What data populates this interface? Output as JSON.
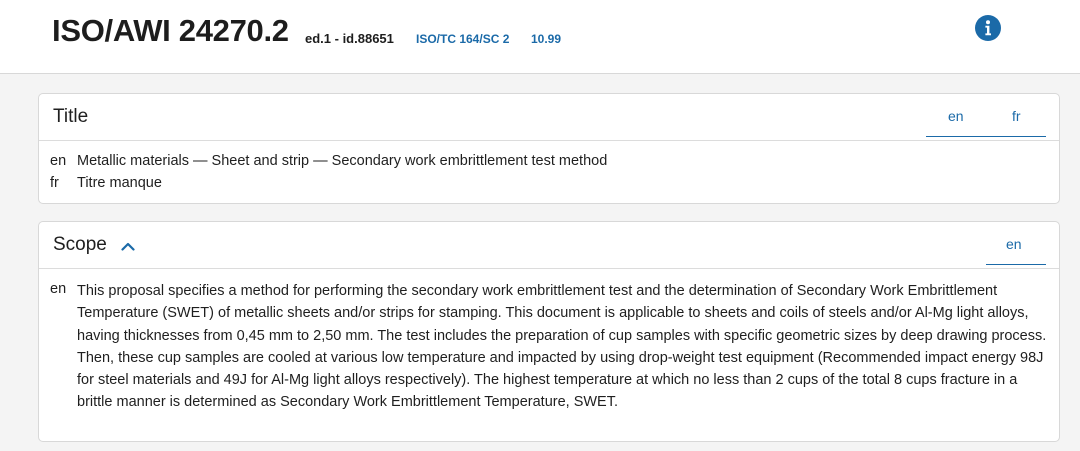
{
  "header": {
    "reference": "ISO/AWI 24270.2",
    "edition": "ed.1 - id.88651",
    "committee": "ISO/TC 164/SC 2",
    "stage": "10.99",
    "info_icon": "info-circle-icon",
    "accent_color": "#1b6aa8"
  },
  "title_section": {
    "heading": "Title",
    "tabs": [
      "en",
      "fr"
    ],
    "rows": [
      {
        "lang": "en",
        "text": "Metallic materials — Sheet and strip — Secondary work embrittlement test method"
      },
      {
        "lang": "fr",
        "text": "Titre manque"
      }
    ]
  },
  "scope_section": {
    "heading": "Scope",
    "toggle_icon": "chevron-up-icon",
    "tabs": [
      "en"
    ],
    "lang": "en",
    "text": "This proposal specifies a method for performing the secondary work embrittlement test and the determination of Secondary Work Embrittlement Temperature (SWET) of metallic sheets and/or strips for stamping. This document is applicable to sheets and coils of steels and/or Al-Mg light alloys, having thicknesses from 0,45 mm to 2,50 mm. The test includes the preparation of cup samples with specific geometric sizes by deep drawing process. Then, these cup samples are cooled at various low temperature and impacted by using drop-weight test equipment (Recommended impact energy 98J for steel materials and 49J for Al-Mg light alloys respectively). The highest temperature at which no less than 2 cups of the total 8 cups fracture in a brittle manner is determined as Secondary Work Embrittlement Temperature, SWET."
  }
}
